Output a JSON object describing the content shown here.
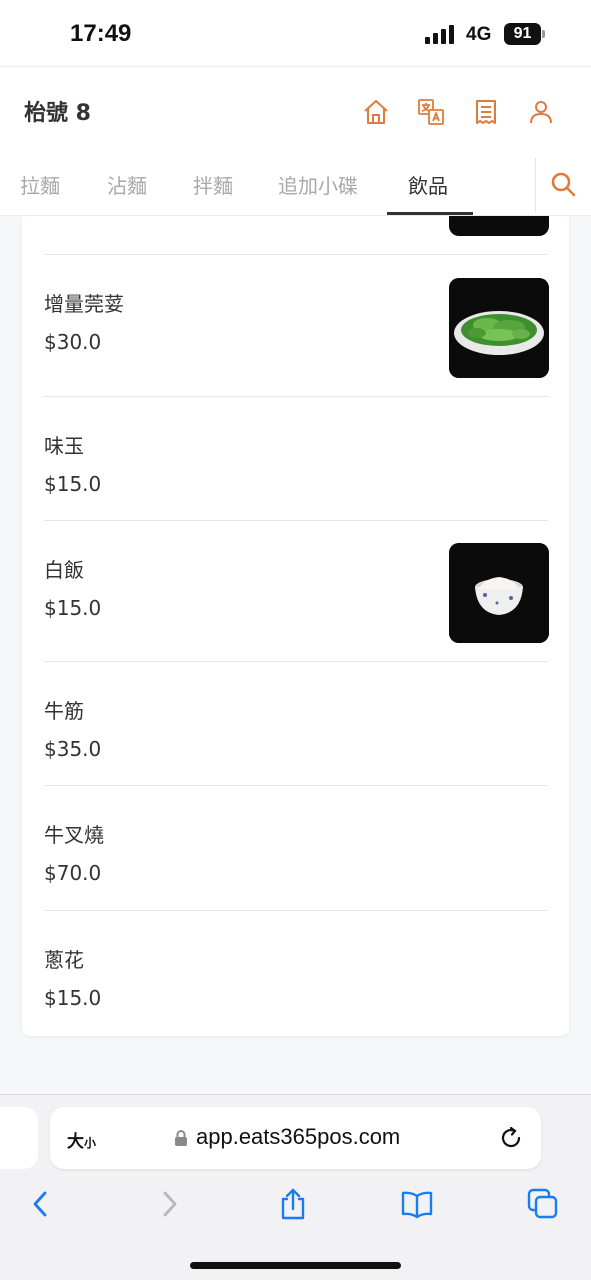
{
  "status_bar": {
    "time": "17:49",
    "network": "4G",
    "battery": "91"
  },
  "header": {
    "table_title": "枱號 8",
    "icons": [
      "home-icon",
      "translate-icon",
      "receipt-icon",
      "user-icon"
    ],
    "accent_color": "#e07b3f"
  },
  "tabs": [
    {
      "label": "拉麵",
      "active": false
    },
    {
      "label": "沾麵",
      "active": false
    },
    {
      "label": "拌麵",
      "active": false
    },
    {
      "label": "追加小碟",
      "active": false
    },
    {
      "label": "飲品",
      "active": true
    }
  ],
  "menu_items": [
    {
      "name": "增量莞荽",
      "price": "$30.0",
      "has_image": true,
      "image": "salad-icon"
    },
    {
      "name": "味玉",
      "price": "$15.0",
      "has_image": false
    },
    {
      "name": "白飯",
      "price": "$15.0",
      "has_image": true,
      "image": "rice-bowl-icon"
    },
    {
      "name": "牛筋",
      "price": "$35.0",
      "has_image": false
    },
    {
      "name": "牛叉燒",
      "price": "$70.0",
      "has_image": false
    },
    {
      "name": "蔥花",
      "price": "$15.0",
      "has_image": false
    }
  ],
  "browser": {
    "text_size_label": "大",
    "text_size_small": "小",
    "url": "app.eats365pos.com"
  }
}
